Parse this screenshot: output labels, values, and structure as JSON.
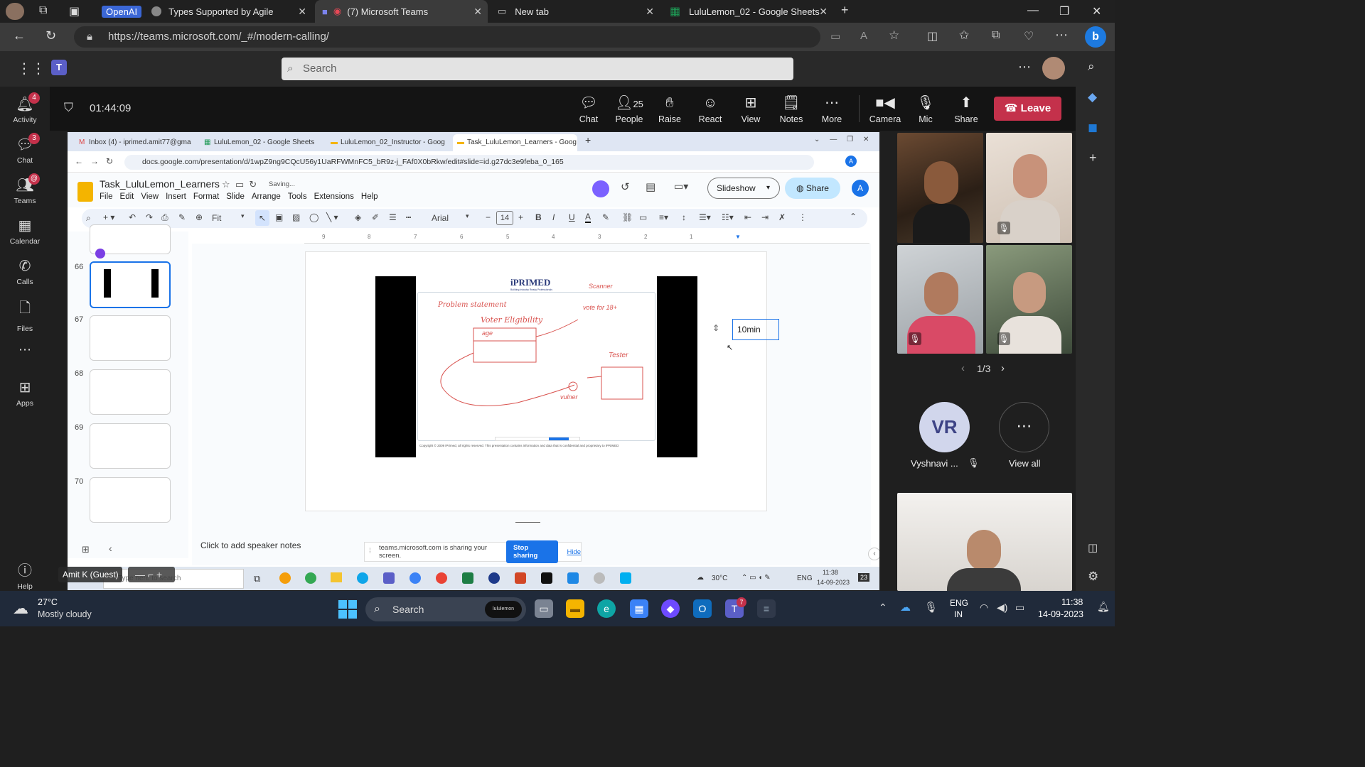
{
  "browser": {
    "tabs": [
      {
        "label": "Types Supported by Agile",
        "group": "OpenAI"
      },
      {
        "label": "(7) Microsoft Teams"
      },
      {
        "label": "New tab"
      },
      {
        "label": "LuluLemon_02 - Google Sheets"
      }
    ],
    "url": "https://teams.microsoft.com/_#/modern-calling/"
  },
  "teams": {
    "search_placeholder": "Search",
    "rail": [
      {
        "label": "Activity",
        "badge": "4"
      },
      {
        "label": "Chat",
        "badge": "3"
      },
      {
        "label": "Teams",
        "badge": "@"
      },
      {
        "label": "Calendar"
      },
      {
        "label": "Calls"
      },
      {
        "label": "Files"
      },
      {
        "label": "Apps"
      },
      {
        "label": "Help"
      }
    ],
    "meeting": {
      "timer": "01:44:09",
      "people_count": "25",
      "tools": [
        "Chat",
        "People",
        "Raise",
        "React",
        "View",
        "Notes",
        "More",
        "Camera",
        "Mic",
        "Share"
      ],
      "leave_label": "Leave"
    },
    "participants": {
      "page": "1/3",
      "avatar_initials": "VR",
      "avatar_name": "Vyshnavi ...",
      "view_all": "View all",
      "guest_label": "Amit K (Guest)"
    }
  },
  "shared": {
    "tabs": [
      "Inbox (4) - iprimed.amit77@gma",
      "LuluLemon_02 - Google Sheets",
      "LuluLemon_02_Instructor - Goog",
      "Task_LuluLemon_Learners - Goog"
    ],
    "url": "docs.google.com/presentation/d/1wpZ9ng9CQcU56y1UaRFWMnFC5_bR9z-j_FAf0X0bRkw/edit#slide=id.g27dc3e9feba_0_165",
    "doc_title": "Task_LuluLemon_Learners",
    "saving": "Saving...",
    "menus": [
      "File",
      "Edit",
      "View",
      "Insert",
      "Format",
      "Slide",
      "Arrange",
      "Tools",
      "Extensions",
      "Help"
    ],
    "slideshow_label": "Slideshow",
    "share_label": "Share",
    "account_initial": "A",
    "toolbar": {
      "zoom": "Fit",
      "font": "Arial",
      "font_size": "14"
    },
    "ruler_ticks": [
      "9",
      "8",
      "7",
      "6",
      "5",
      "4",
      "3",
      "2",
      "1"
    ],
    "thumb_numbers": [
      "66",
      "67",
      "68",
      "69",
      "70"
    ],
    "slide": {
      "logo_text": "iPRIMED",
      "logo_tag": "Building Industry Ready Professionals",
      "handwriting": [
        "Problem statement",
        "Voter Eligibility",
        "age",
        "vote for 18+",
        "Scanner",
        "Tester",
        "vulner"
      ],
      "copyright": "Copyright © 2009 iPrimed, all rights reserved. This presentation contains information and data that is confidential and proprietary to iPRIMED",
      "textbox": "10min"
    },
    "speaker_notes": "Click to add speaker notes",
    "share_notice": "teams.microsoft.com is sharing your screen.",
    "stop_sharing": "Stop sharing",
    "hide": "Hide",
    "inner_taskbar": {
      "search": "Type here to search",
      "temp": "30°C",
      "lang": "ENG",
      "time": "11:38",
      "date": "14-09-2023",
      "notif": "23"
    }
  },
  "taskbar": {
    "weather_temp": "27°C",
    "weather_desc": "Mostly cloudy",
    "search": "Search",
    "search_pill": "lululemon",
    "lang1": "ENG",
    "lang2": "IN",
    "time": "11:38",
    "date": "14-09-2023",
    "teams_badge": "7"
  },
  "colors": {
    "teams_purple": "#5b5fc7",
    "leave_red": "#c4314b",
    "slides_blue": "#1a73e8"
  }
}
